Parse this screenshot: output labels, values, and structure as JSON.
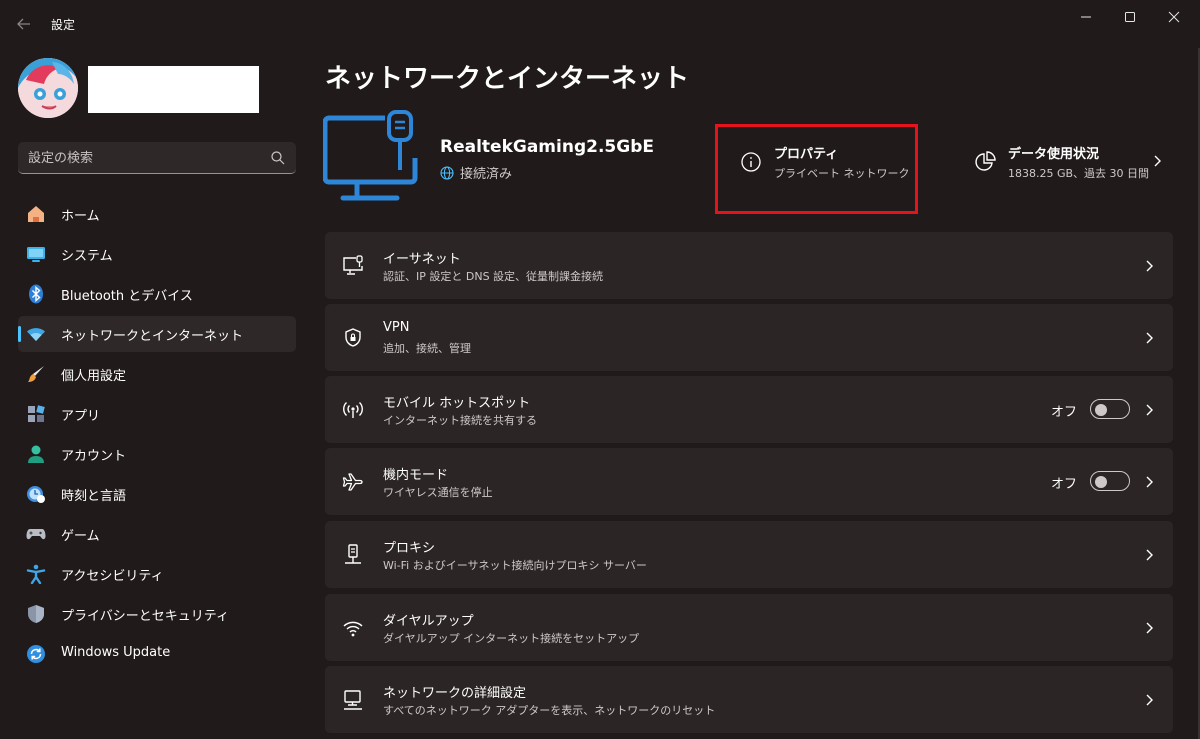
{
  "window": {
    "title": "設定"
  },
  "sidebar": {
    "search_placeholder": "設定の検索",
    "items": [
      {
        "label": "ホーム",
        "icon": "home-icon"
      },
      {
        "label": "システム",
        "icon": "system-icon"
      },
      {
        "label": "Bluetooth とデバイス",
        "icon": "bluetooth-icon"
      },
      {
        "label": "ネットワークとインターネット",
        "icon": "wifi-icon",
        "selected": true
      },
      {
        "label": "個人用設定",
        "icon": "brush-icon"
      },
      {
        "label": "アプリ",
        "icon": "apps-icon"
      },
      {
        "label": "アカウント",
        "icon": "account-icon"
      },
      {
        "label": "時刻と言語",
        "icon": "time-language-icon"
      },
      {
        "label": "ゲーム",
        "icon": "gamepad-icon"
      },
      {
        "label": "アクセシビリティ",
        "icon": "accessibility-icon"
      },
      {
        "label": "プライバシーとセキュリティ",
        "icon": "shield-icon"
      },
      {
        "label": "Windows Update",
        "icon": "windows-update-icon"
      }
    ]
  },
  "main": {
    "title": "ネットワークとインターネット",
    "adapter": {
      "name": "RealtekGaming2.5GbE",
      "status": "接続済み"
    },
    "properties": {
      "title": "プロパティ",
      "subtitle": "プライベート ネットワーク"
    },
    "data_usage": {
      "title": "データ使用状況",
      "subtitle": "1838.25 GB、過去 30 日間"
    },
    "cards": [
      {
        "title": "イーサネット",
        "subtitle": "認証、IP 設定と DNS 設定、従量制課金接続",
        "icon": "ethernet-icon"
      },
      {
        "title": "VPN",
        "subtitle": "追加、接続、管理",
        "icon": "vpn-shield-icon"
      },
      {
        "title": "モバイル ホットスポット",
        "subtitle": "インターネット接続を共有する",
        "icon": "hotspot-icon",
        "toggle": "オフ"
      },
      {
        "title": "機内モード",
        "subtitle": "ワイヤレス通信を停止",
        "icon": "airplane-icon",
        "toggle": "オフ"
      },
      {
        "title": "プロキシ",
        "subtitle": "Wi-Fi およびイーサネット接続向けプロキシ サーバー",
        "icon": "proxy-icon"
      },
      {
        "title": "ダイヤルアップ",
        "subtitle": "ダイヤルアップ インターネット接続をセットアップ",
        "icon": "dialup-icon"
      },
      {
        "title": "ネットワークの詳細設定",
        "subtitle": "すべてのネットワーク アダプターを表示、ネットワークのリセット",
        "icon": "advanced-network-icon"
      }
    ]
  },
  "colors": {
    "accent": "#4cc2ff",
    "highlight_box": "#e5131b",
    "background": "#201a1a",
    "card": "#2b2525"
  }
}
